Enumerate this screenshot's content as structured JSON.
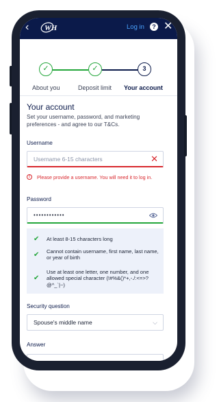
{
  "header": {
    "logo_text": "WH",
    "login_label": "Log in",
    "help_icon": "help-icon",
    "back_icon": "back-arrow-icon",
    "close_icon": "close-icon",
    "colors": {
      "bar": "#0b1a4a",
      "link": "#4aa3ff"
    }
  },
  "stepper": {
    "steps": [
      {
        "label": "About you",
        "state": "complete"
      },
      {
        "label": "Deposit limit",
        "state": "complete"
      },
      {
        "label": "Your account",
        "state": "current",
        "number": "3"
      }
    ],
    "colors": {
      "complete": "#23a63a",
      "current": "#0b1a4a"
    }
  },
  "form": {
    "title": "Your account",
    "subtitle": "Set your username, password, and marketing preferences - and agree to our T&Cs.",
    "username": {
      "label": "Username",
      "placeholder": "Username 6-15 characters",
      "error": "Please provide a username. You will need it to log in."
    },
    "password": {
      "label": "Password",
      "value": "••••••••••••",
      "rules": [
        "At least 8-15 characters long",
        "Cannot contain username, first name, last name, or year of birth",
        "Use at least one letter, one number, and one allowed special character (!#%&()*+,-./:<=>?@^_`|~)"
      ]
    },
    "security_question": {
      "label": "Security question",
      "selected": "Spouse's middle name"
    },
    "answer": {
      "label": "Answer",
      "value": ""
    },
    "colors": {
      "error": "#d8262c",
      "valid": "#23a63a",
      "rules_bg": "#edf1fa"
    }
  }
}
